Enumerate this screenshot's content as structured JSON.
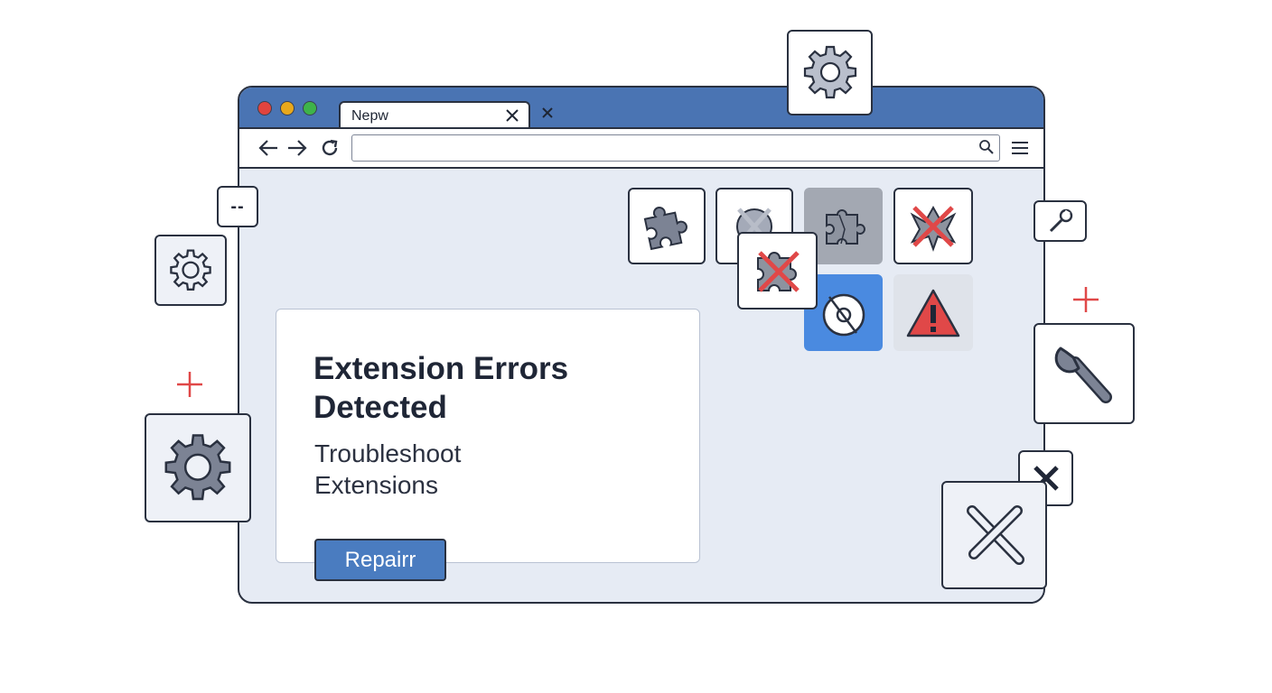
{
  "browser": {
    "tab": {
      "label": "Nepw"
    },
    "address": {
      "value": ""
    }
  },
  "main": {
    "title": "Extension Errors Detected",
    "subtitle": "Troubleshoot Extensions",
    "repair_label": "Repairr"
  },
  "floating": {
    "dash_label": "--"
  },
  "colors": {
    "titlebar": "#4a74b3",
    "accent": "#4a7cc0",
    "error_red": "#e04848",
    "page_bg": "#e6ebf4",
    "icon_gray": "#7c8394"
  },
  "icons": [
    "puzzle-icon",
    "broken-extension-icon",
    "puzzle-outline-icon",
    "broken-extension-x-icon",
    "puzzle-error-icon",
    "blocked-disc-icon",
    "warning-icon",
    "gear-icon",
    "wrench-icon",
    "tools-icon"
  ]
}
